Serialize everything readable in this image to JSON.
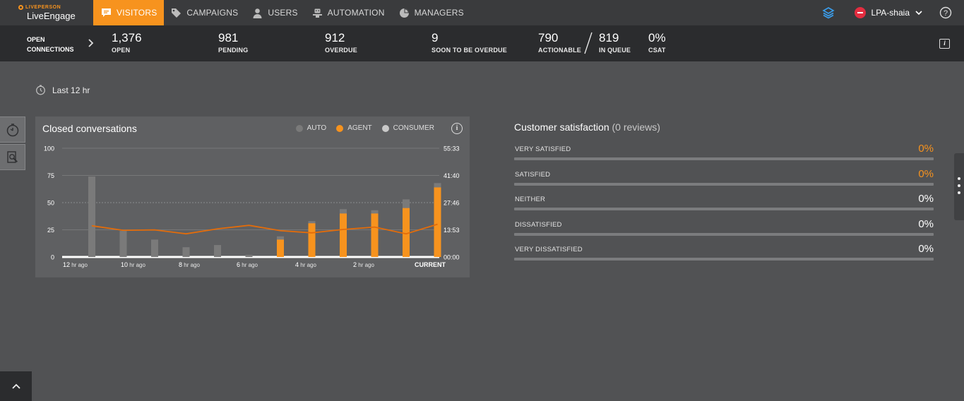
{
  "nav": {
    "brand_small": "LIVEPERSON",
    "brand_big": "LiveEngage",
    "items": [
      {
        "label": "VISITORS",
        "icon": "chat-bubble-icon",
        "active": true
      },
      {
        "label": "CAMPAIGNS",
        "icon": "tag-icon"
      },
      {
        "label": "USERS",
        "icon": "user-icon"
      },
      {
        "label": "AUTOMATION",
        "icon": "bot-icon"
      },
      {
        "label": "MANAGERS",
        "icon": "pie-chart-icon"
      }
    ],
    "username": "LPA-shaia",
    "accent": "#f7931e"
  },
  "stats": {
    "open_connections_line1": "OPEN",
    "open_connections_line2": "CONNECTIONS",
    "open": {
      "value": "1,376",
      "label": "OPEN"
    },
    "pending": {
      "value": "981",
      "label": "PENDING"
    },
    "overdue": {
      "value": "912",
      "label": "OVERDUE"
    },
    "soon": {
      "value": "9",
      "label": "SOON TO BE OVERDUE"
    },
    "actionable": {
      "value": "790",
      "label": "ACTIONABLE"
    },
    "inqueue": {
      "value": "819",
      "label": "IN QUEUE"
    },
    "csat": {
      "value": "0%",
      "label": "CSAT"
    }
  },
  "period": "Last 12 hr",
  "panel": {
    "title": "Closed conversations",
    "legend": [
      "AUTO",
      "AGENT",
      "CONSUMER"
    ]
  },
  "chart_data": {
    "type": "bar",
    "categories": [
      "12 hr ago",
      "",
      "10 hr ago",
      "",
      "8 hr ago",
      "",
      "6 hr ago",
      "",
      "4 hr ago",
      "",
      "2 hr ago",
      "",
      "CURRENT"
    ],
    "x_tick_labels": [
      {
        "big": "12",
        "small": " hr ago"
      },
      {
        "big": "10",
        "small": " hr ago"
      },
      {
        "big": "8",
        "small": " hr ago"
      },
      {
        "big": "6",
        "small": " hr ago"
      },
      {
        "big": "4",
        "small": " hr ago"
      },
      {
        "big": "2",
        "small": " hr ago"
      },
      {
        "big": "CURRENT",
        "small": ""
      }
    ],
    "series": [
      {
        "name": "AUTO",
        "color": "#7a7a7a",
        "values": [
          74,
          24,
          16,
          9,
          11,
          2,
          19,
          33,
          44,
          43,
          53,
          68
        ]
      },
      {
        "name": "AGENT",
        "color": "#f7931e",
        "values": [
          0,
          0,
          0,
          0,
          0,
          0,
          16,
          31,
          40,
          40,
          45,
          64
        ]
      }
    ],
    "line": {
      "color": "#e36c0a",
      "values": [
        28.7,
        24.5,
        24.9,
        21.3,
        25.9,
        29.1,
        24.2,
        22.2,
        25.3,
        27.5,
        21.3,
        30.1
      ]
    },
    "yleft_ticks": [
      "100",
      "75",
      "50",
      "25",
      "0"
    ],
    "yright_ticks": [
      "55:33",
      "41:40",
      "27:46",
      "13:53",
      "00:00"
    ],
    "ylim": [
      0,
      100
    ],
    "yright_lim": [
      "00:00",
      "55:33"
    ]
  },
  "csat": {
    "title": "Customer satisfaction",
    "reviews": "(0 reviews)",
    "rows": [
      {
        "label": "VERY SATISFIED",
        "value": "0%"
      },
      {
        "label": "SATISFIED",
        "value": "0%"
      },
      {
        "label": "NEITHER",
        "value": "0%"
      },
      {
        "label": "DISSATISFIED",
        "value": "0%"
      },
      {
        "label": "VERY DISSATISFIED",
        "value": "0%"
      }
    ]
  }
}
